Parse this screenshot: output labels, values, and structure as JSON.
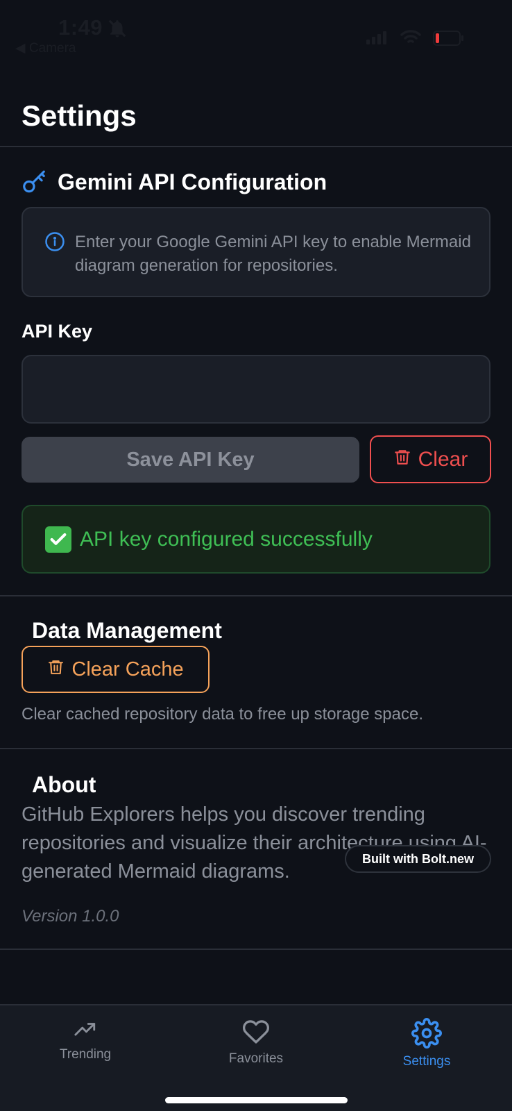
{
  "status_bar": {
    "time": "1:49",
    "back_label": "◀ Camera",
    "icons": [
      "bell-slash-icon",
      "signal-icon",
      "wifi-icon",
      "battery-low-icon"
    ]
  },
  "page": {
    "title": "Settings"
  },
  "gemini": {
    "heading": "Gemini API Configuration",
    "icon": "key-icon",
    "info_text": "Enter your Google Gemini API key to enable Mermaid diagram generation for repositories.",
    "api_key_label": "API Key",
    "api_key_value": "",
    "save_label": "Save API Key",
    "clear_label": "Clear",
    "success_text": "API key configured successfully"
  },
  "data_management": {
    "heading": "Data Management",
    "clear_cache_label": "Clear Cache",
    "description": "Clear cached repository data to free up storage space."
  },
  "about": {
    "heading": "About",
    "text": "GitHub Explorers helps you discover trending repositories and visualize their architecture using AI-generated Mermaid diagrams.",
    "version": "Version 1.0.0",
    "badge": "Built with Bolt.new"
  },
  "tabs": [
    {
      "label": "Trending",
      "icon": "trending-up-icon",
      "active": false
    },
    {
      "label": "Favorites",
      "icon": "heart-icon",
      "active": false
    },
    {
      "label": "Settings",
      "icon": "gear-icon",
      "active": true
    }
  ],
  "colors": {
    "background": "#0e1118",
    "accent": "#3b8ff0",
    "danger": "#ef4f4f",
    "warning": "#f5a25a",
    "success": "#3fbf55"
  }
}
